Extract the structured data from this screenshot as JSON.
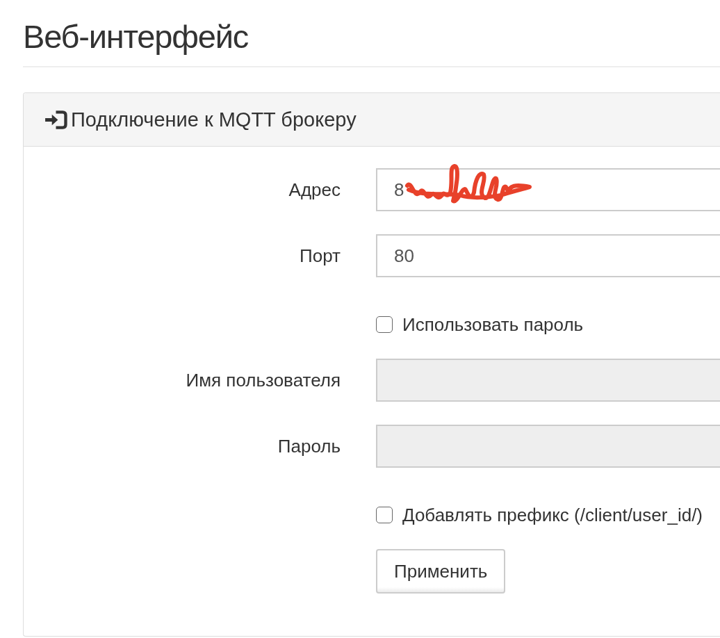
{
  "page": {
    "title": "Веб-интерфейс"
  },
  "panel": {
    "title": "Подключение к MQTT брокеру",
    "rows": [
      {
        "kind": "field",
        "label": "Адрес",
        "value": "8",
        "disabled": false,
        "redacted": true
      },
      {
        "kind": "field",
        "label": "Порт",
        "value": "80",
        "disabled": false
      },
      {
        "kind": "checkbox",
        "label": "Использовать пароль",
        "checked": false
      },
      {
        "kind": "field",
        "label": "Имя пользователя",
        "disabled": true
      },
      {
        "kind": "field",
        "label": "Пароль",
        "disabled": true
      },
      {
        "kind": "checkbox",
        "label": "Добавлять префикс (/client/user_id/)",
        "checked": false
      },
      {
        "kind": "button",
        "label": "Применить"
      }
    ]
  }
}
